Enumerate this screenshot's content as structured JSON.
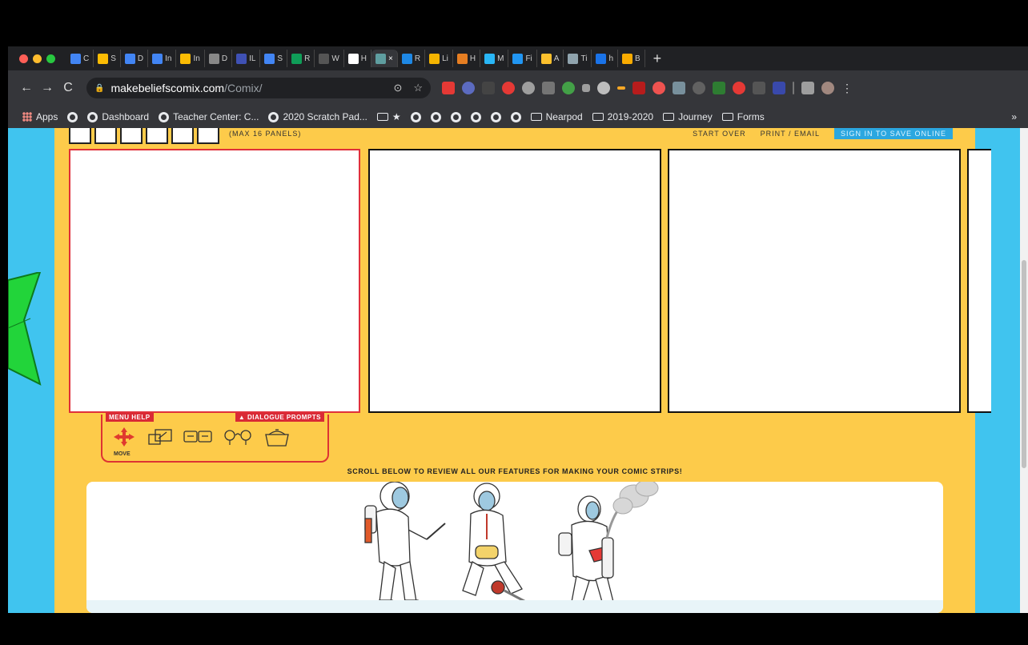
{
  "browser": {
    "tabs": [
      {
        "label": "C",
        "color": "#4285f4"
      },
      {
        "label": "S",
        "color": "#fbbc04"
      },
      {
        "label": "D",
        "color": "#4285f4"
      },
      {
        "label": "In",
        "color": "#4285f4"
      },
      {
        "label": "In",
        "color": "#fbbc04"
      },
      {
        "label": "D",
        "color": "#888888"
      },
      {
        "label": "IL",
        "color": "#3f51b5"
      },
      {
        "label": "S",
        "color": "#4285f4"
      },
      {
        "label": "R",
        "color": "#0f9d58"
      },
      {
        "label": "W",
        "color": "#555555"
      },
      {
        "label": "H",
        "color": "#ffffff"
      },
      {
        "label": "×",
        "color": "#5f9ea0",
        "active": true
      },
      {
        "label": "R",
        "color": "#1e88e5"
      },
      {
        "label": "Li",
        "color": "#f4b400"
      },
      {
        "label": "H",
        "color": "#e67e22"
      },
      {
        "label": "M",
        "color": "#29b6f6"
      },
      {
        "label": "Fi",
        "color": "#2196f3"
      },
      {
        "label": "A",
        "color": "#fbc02d"
      },
      {
        "label": "Ti",
        "color": "#90a4ae"
      },
      {
        "label": "h",
        "color": "#1a73e8"
      },
      {
        "label": "B",
        "color": "#f9ab00"
      }
    ],
    "new_tab_symbol": "+",
    "nav": {
      "back": "←",
      "forward": "→",
      "reload": "C"
    },
    "url_host": "makebeliefscomix.com",
    "url_path": "/Comix/",
    "omnibox_icons": [
      "⊙",
      "☆"
    ],
    "bookmarks": {
      "apps": "Apps",
      "items": [
        {
          "label": "",
          "type": "globe"
        },
        {
          "label": "Dashboard",
          "type": "globe"
        },
        {
          "label": "Teacher Center: C...",
          "type": "globe"
        },
        {
          "label": "2020 Scratch Pad...",
          "type": "globe"
        },
        {
          "label": "★",
          "type": "folder"
        },
        {
          "label": "",
          "type": "globe"
        },
        {
          "label": "",
          "type": "globe"
        },
        {
          "label": "",
          "type": "globe"
        },
        {
          "label": "",
          "type": "globe"
        },
        {
          "label": "",
          "type": "globe"
        },
        {
          "label": "",
          "type": "globe"
        },
        {
          "label": "Nearpod",
          "type": "folder"
        },
        {
          "label": "2019-2020",
          "type": "folder"
        },
        {
          "label": "Journey",
          "type": "folder"
        },
        {
          "label": "Forms",
          "type": "folder"
        }
      ],
      "more": "»"
    }
  },
  "comic": {
    "panel_buttons": [
      "",
      "",
      "",
      "",
      "",
      ""
    ],
    "panel_count_label": "(MAX 16 PANELS)",
    "start_over": "START OVER",
    "print_email": "PRINT / EMAIL",
    "sign_in": "SIGN IN TO SAVE ONLINE",
    "menu_help": "MENU HELP",
    "dialogue_prompts": "▲ DIALOGUE PROMPTS",
    "move_label": "MOVE",
    "scroll_message": "SCROLL BELOW TO REVIEW ALL OUR FEATURES FOR MAKING YOUR COMIC STRIPS!"
  },
  "colors": {
    "page_bg": "#40c4ef",
    "comic_bg": "#fdcb4a",
    "selected_border": "#e0303a",
    "accent_red": "#d92a35",
    "arrow_green": "#22d43a"
  }
}
